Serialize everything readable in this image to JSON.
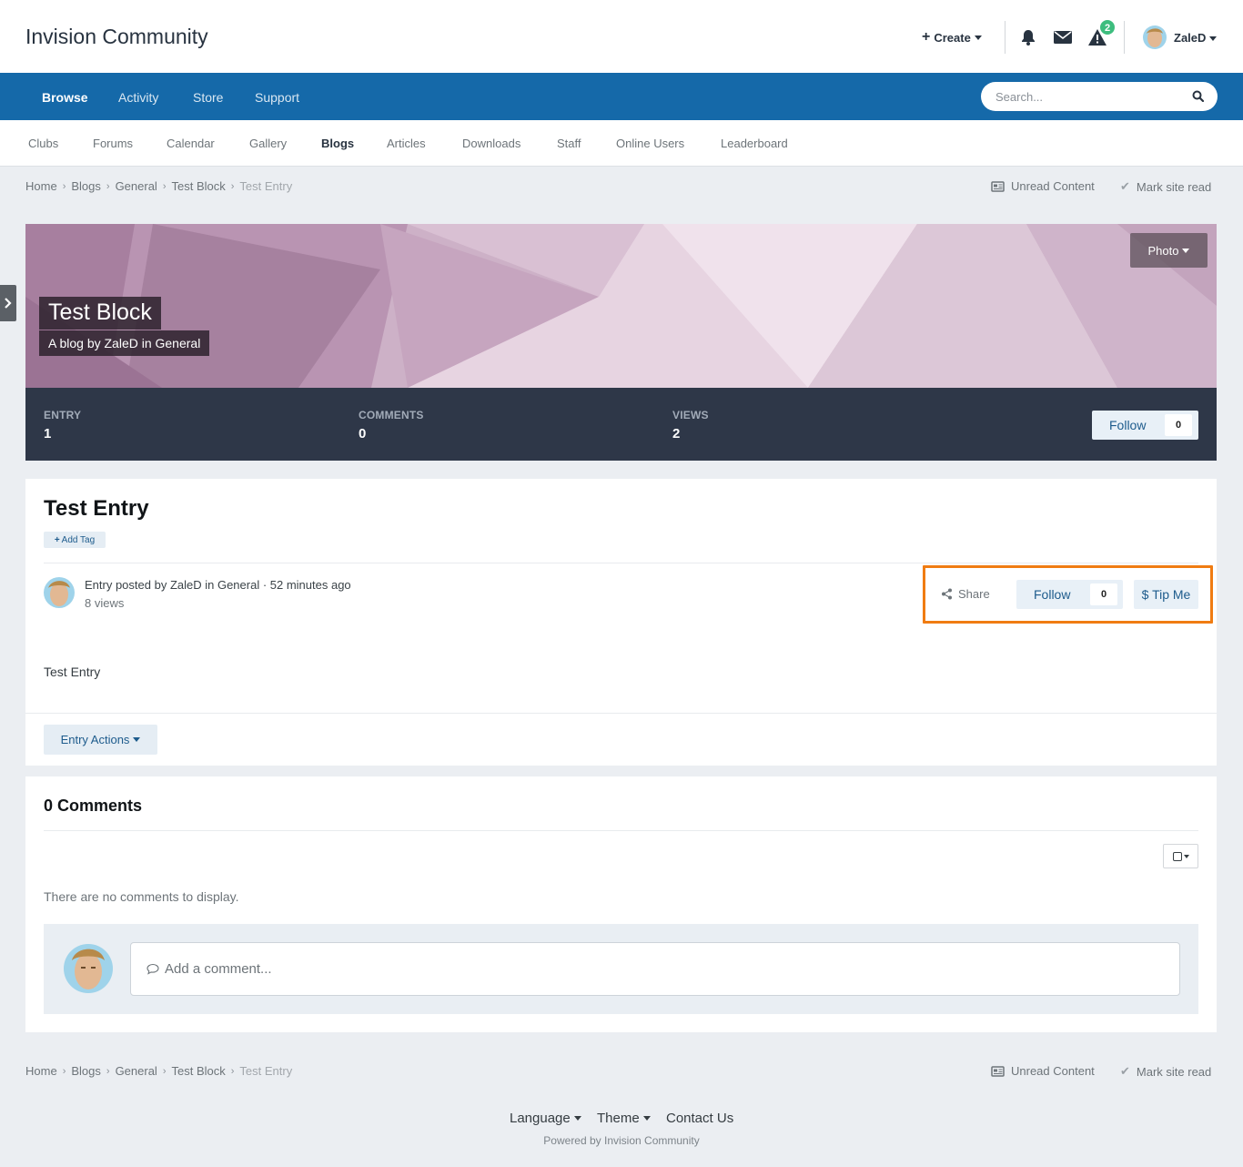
{
  "header": {
    "logo": "Invision Community",
    "create_label": "Create",
    "notification_count": "2",
    "username": "ZaleD"
  },
  "nav": {
    "items": [
      "Browse",
      "Activity",
      "Store",
      "Support"
    ],
    "active": "Browse",
    "search_placeholder": "Search..."
  },
  "subnav": {
    "items": [
      "Clubs",
      "Forums",
      "Calendar",
      "Gallery",
      "Blogs",
      "Articles",
      "Downloads",
      "Staff",
      "Online Users",
      "Leaderboard"
    ],
    "active": "Blogs"
  },
  "breadcrumb": [
    "Home",
    "Blogs",
    "General",
    "Test Block",
    "Test Entry"
  ],
  "top_links": {
    "unread": "Unread Content",
    "mark_read": "Mark site read"
  },
  "blog": {
    "photo_label": "Photo",
    "title": "Test Block",
    "subtitle": "A blog by ZaleD in General",
    "stats": [
      {
        "label": "ENTRY",
        "value": "1"
      },
      {
        "label": "COMMENTS",
        "value": "0"
      },
      {
        "label": "VIEWS",
        "value": "2"
      }
    ],
    "follow_label": "Follow",
    "follow_count": "0"
  },
  "entry": {
    "title": "Test Entry",
    "add_tag": "Add Tag",
    "meta_line": "Entry posted by ZaleD in General · 52 minutes ago",
    "views": "8 views",
    "share_label": "Share",
    "follow_label": "Follow",
    "follow_count": "0",
    "tip_label": "$ Tip Me",
    "body": "Test Entry",
    "actions_label": "Entry Actions"
  },
  "comments": {
    "title": "0 Comments",
    "empty_text": "There are no comments to display.",
    "add_placeholder": "Add a comment..."
  },
  "footer": {
    "language": "Language",
    "theme": "Theme",
    "contact": "Contact Us",
    "powered": "Powered by Invision Community"
  },
  "colors": {
    "nav_bg": "#1569a9",
    "stats_bg": "#2e3748",
    "highlight": "#f07c12",
    "badge": "#3dbd7e"
  }
}
